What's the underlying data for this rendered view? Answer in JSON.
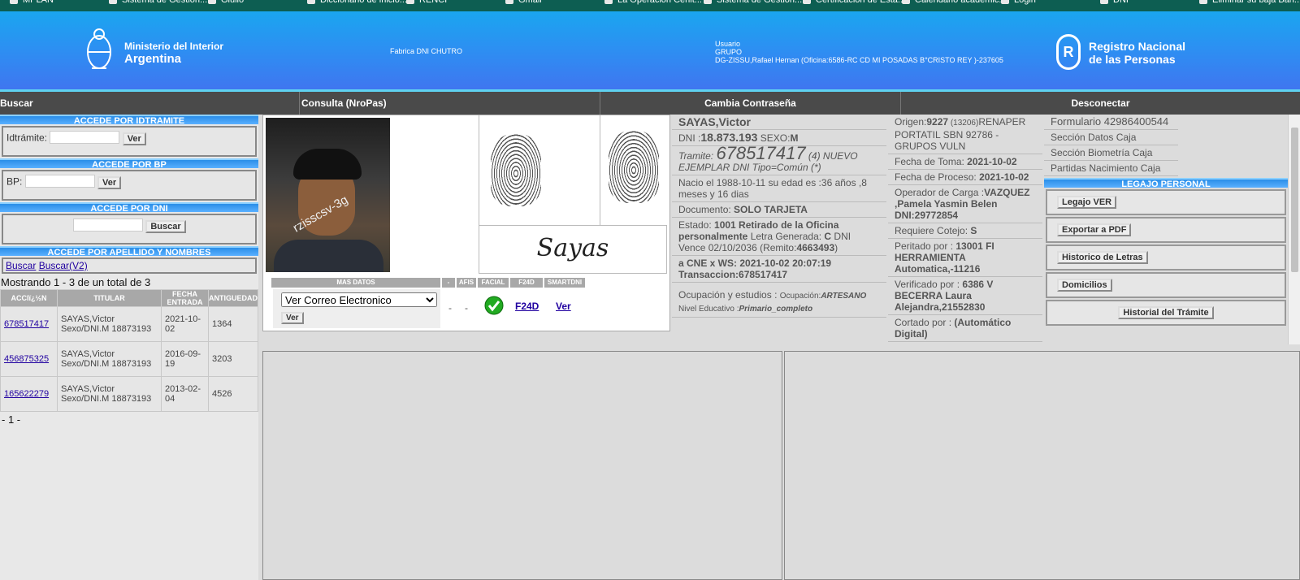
{
  "bookmarks": [
    "MPLAN",
    "Sistema de Gestión...",
    "Giulio",
    "Diccionario de inicio...",
    "RENCI",
    "Gmail",
    "La Operación Cenit...",
    "Sistema de Gestión...",
    "Certificación de Esta...",
    "Calendario académic...",
    "Login",
    "DNI",
    "Eliminar su baja Ban..."
  ],
  "header": {
    "ministerio_line1": "Ministerio del Interior",
    "ministerio_line2": "Argentina",
    "fabrica": "Fabrica DNI CHUTRO",
    "usuario_label": "Usuario",
    "grupo": "GRUPO",
    "usuario_detail": "DG-ZISSU,Rafael Hernan (Oficina:6586-RC CD MI POSADAS B°CRISTO REY )-237605",
    "registro_line1": "Registro Nacional",
    "registro_line2": "de las Personas"
  },
  "nav": {
    "buscar": "Buscar",
    "consulta": "Consulta (NroPas)",
    "cambia": "Cambia Contraseña",
    "desconectar": "Desconectar"
  },
  "left": {
    "idtramite_head": "ACCEDE POR IDTRAMITE",
    "idtramite_label": "Idtrámite:",
    "ver": "Ver",
    "bp_head": "ACCEDE POR BP",
    "bp_label": "BP:",
    "dni_head": "ACCEDE POR DNI",
    "buscar_btn": "Buscar",
    "apellido_head": "ACCEDE POR APELLIDO Y NOMBRES",
    "buscar_link": "Buscar",
    "buscar_v2": "Buscar(V2)",
    "mostrando": "Mostrando 1 - 3 de un total de 3",
    "cols": [
      "ACCIï¿½N",
      "TITULAR",
      "FECHA ENTRADA",
      "ANTIGUEDAD"
    ],
    "rows": [
      {
        "accion": "678517417",
        "titular": "SAYAS,Victor Sexo/DNI.M 18873193",
        "fecha": "2021-10-02",
        "antig": "1364"
      },
      {
        "accion": "456875325",
        "titular": "SAYAS,Victor Sexo/DNI.M 18873193",
        "fecha": "2016-09-19",
        "antig": "3203"
      },
      {
        "accion": "165622279",
        "titular": "SAYAS,Victor Sexo/DNI.M 18873193",
        "fecha": "2013-02-04",
        "antig": "4526"
      }
    ],
    "pager": "- 1 -"
  },
  "center": {
    "watermark": "rzisscsv-3g",
    "signature": "Sayas",
    "mas_datos_head": "MAS DATOS",
    "dash_head": "-",
    "afis_head": "AFIS",
    "facial_head": "FACIAL",
    "f24d_head": "F24D",
    "smartdni_head": "SMARTDNI",
    "select_value": "Ver Correo Electronico",
    "ver_btn": "Ver",
    "dash1": "-",
    "dash2": "-",
    "f24d_link": "F24D",
    "ver_link": "Ver"
  },
  "datos1": {
    "nombre": "SAYAS,Victor",
    "dni_label": "DNI :",
    "dni": "18.873.193",
    "sexo_label": " SEXO:",
    "sexo": "M",
    "tramite_label": "Tramite: ",
    "tramite": "678517417",
    "tramite_rest": " (4) NUEVO EJEMPLAR DNI Tipo=Común (*)",
    "nacio": "Nacio el 1988-10-11 su edad es :36 años ,8 meses y 16 dias",
    "documento_label": "Documento: ",
    "documento": "SOLO TARJETA",
    "estado_label": "Estado: ",
    "estado": "1001 Retirado de la Oficina personalmente",
    "estado_rest": " Letra Generada: ",
    "letra": "C",
    "vence": " DNI Vence 02/10/2036 (Remito:",
    "remito": "4663493",
    "vence_end": ")",
    "cne": "a CNE x WS: 2021-10-02 20:07:19",
    "transaccion": "Transaccion:678517417",
    "ocupacion_label": "Ocupación y estudios : ",
    "ocup_small": "Ocupación:",
    "ocupacion": "ARTESANO",
    "nivel_label": "Nivel Educativo :",
    "nivel": "Primario_completo"
  },
  "datos2": {
    "origen_label": "Origen:",
    "origen": "9227",
    "origen_small": " (13206)",
    "origen_rest": "RENAPER PORTATIL SBN 92786 - GRUPOS VULN",
    "toma_label": "Fecha de Toma: ",
    "toma": "2021-10-02",
    "proceso_label": "Fecha de Proceso: ",
    "proceso": "2021-10-02",
    "operador_label": "Operador de Carga :",
    "operador": "VAZQUEZ ,Pamela Yasmin Belen DNI:29772854",
    "cotejo_label": "Requiere Cotejo: ",
    "cotejo": "S",
    "peritado_label": "Peritado por : ",
    "peritado": "13001 FI HERRAMIENTA Automatica,-11216",
    "verificado_label": "Verificado por : ",
    "verificado": "6386 V BECERRA Laura Alejandra,21552830",
    "cortado_label": "Cortado por : ",
    "cortado": "(Automático Digital)"
  },
  "datos3": {
    "formulario": "Formulario 42986400544",
    "seccion_datos": "Sección Datos Caja",
    "seccion_bio": "Sección Biometría Caja",
    "partidas": "Partidas Nacimiento Caja",
    "legajo_head": "LEGAJO PERSONAL",
    "legajo_ver": "Legajo VER",
    "exportar": "Exportar a PDF",
    "historico_letras": "Historico de Letras",
    "domicilios": "Domicilios",
    "historial": "Historial del Trámite"
  }
}
